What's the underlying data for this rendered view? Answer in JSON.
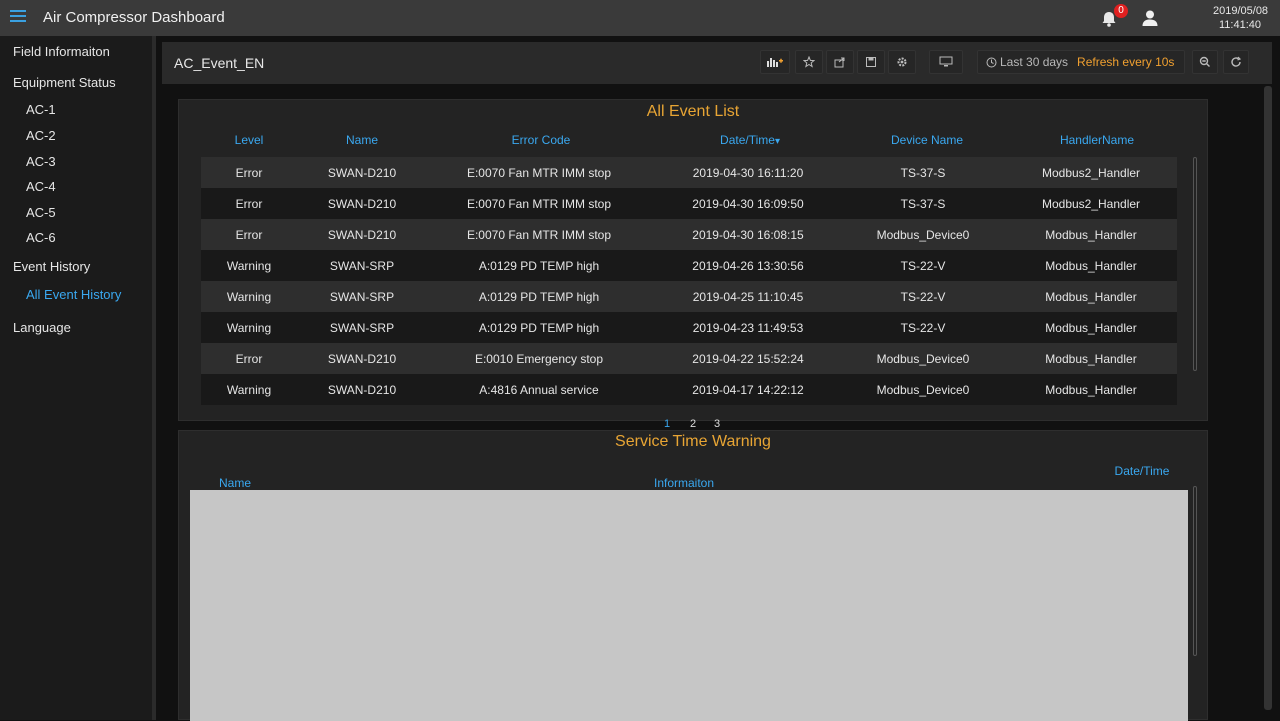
{
  "app": {
    "title": "Air Compressor Dashboard",
    "notification_count": "0",
    "date": "2019/05/08",
    "time": "11:41:40"
  },
  "sidebar": {
    "items": [
      {
        "label": "Field Informaiton"
      },
      {
        "label": "Equipment Status"
      },
      {
        "label": "AC-1"
      },
      {
        "label": "AC-2"
      },
      {
        "label": "AC-3"
      },
      {
        "label": "AC-4"
      },
      {
        "label": "AC-5"
      },
      {
        "label": "AC-6"
      },
      {
        "label": "Event History"
      },
      {
        "label": "All Event History"
      },
      {
        "label": "Language"
      }
    ]
  },
  "dashboard": {
    "title": "AC_Event_EN",
    "time_range": "Last 30 days",
    "refresh": "Refresh every 10s"
  },
  "event_panel": {
    "title": "All Event List",
    "columns": [
      "Level",
      "Name",
      "Error Code",
      "Date/Time",
      "Device Name",
      "HandlerName"
    ],
    "sort_indicator": "▾",
    "rows": [
      [
        "Error",
        "SWAN-D210",
        "E:0070 Fan MTR IMM stop",
        "2019-04-30 16:11:20",
        "TS-37-S",
        "Modbus2_Handler"
      ],
      [
        "Error",
        "SWAN-D210",
        "E:0070 Fan MTR IMM stop",
        "2019-04-30 16:09:50",
        "TS-37-S",
        "Modbus2_Handler"
      ],
      [
        "Error",
        "SWAN-D210",
        "E:0070 Fan MTR IMM stop",
        "2019-04-30 16:08:15",
        "Modbus_Device0",
        "Modbus_Handler"
      ],
      [
        "Warning",
        "SWAN-SRP",
        "A:0129 PD TEMP high",
        "2019-04-26 13:30:56",
        "TS-22-V",
        "Modbus_Handler"
      ],
      [
        "Warning",
        "SWAN-SRP",
        "A:0129 PD TEMP high",
        "2019-04-25 11:10:45",
        "TS-22-V",
        "Modbus_Handler"
      ],
      [
        "Warning",
        "SWAN-SRP",
        "A:0129 PD TEMP high",
        "2019-04-23 11:49:53",
        "TS-22-V",
        "Modbus_Handler"
      ],
      [
        "Error",
        "SWAN-D210",
        "E:0010 Emergency stop",
        "2019-04-22 15:52:24",
        "Modbus_Device0",
        "Modbus_Handler"
      ],
      [
        "Warning",
        "SWAN-D210",
        "A:4816 Annual service",
        "2019-04-17 14:22:12",
        "Modbus_Device0",
        "Modbus_Handler"
      ]
    ],
    "pages": [
      "1",
      "2",
      "3"
    ]
  },
  "service_panel": {
    "title": "Service Time Warning",
    "columns": [
      "Name",
      "Informaiton",
      "Date/Time"
    ]
  }
}
